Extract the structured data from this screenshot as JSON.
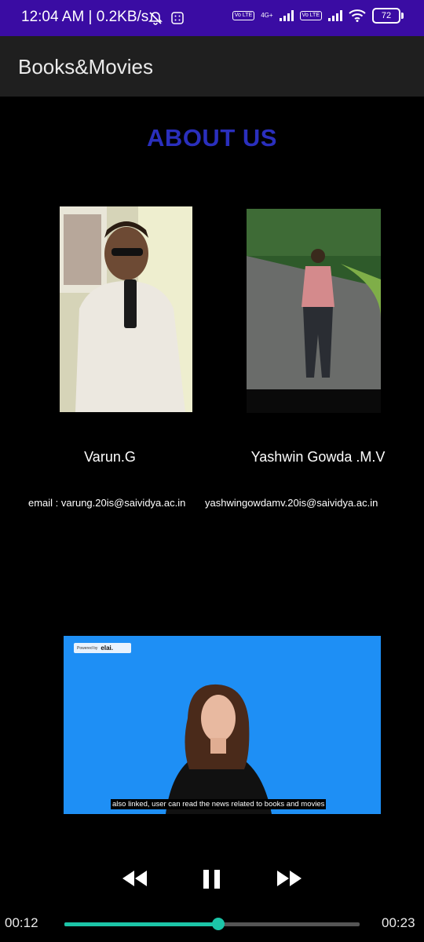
{
  "status_bar": {
    "time": "12:04 AM | 0.2KB/s",
    "volte1": "Vo LTE",
    "network": "4G+",
    "volte2": "Vo LTE",
    "battery": "72"
  },
  "app_bar": {
    "title": "Books&Movies"
  },
  "page": {
    "heading": "ABOUT US",
    "members": [
      {
        "name": "Varun.G",
        "email": "email : varung.20is@saividya.ac.in"
      },
      {
        "name": "Yashwin Gowda .M.V",
        "email": "yashwingowdamv.20is@saividya.ac.in"
      }
    ]
  },
  "video": {
    "badge_small": "Powered by",
    "badge_brand": "elai.",
    "caption": "also linked, user can read the news related to books and movies"
  },
  "player": {
    "elapsed": "00:12",
    "duration": "00:23",
    "progress": 0.52
  },
  "colors": {
    "status_bar": "#3a0ca3",
    "heading": "#2a2fbd",
    "accent": "#1cc5a8",
    "video_bg": "#1e8ff5"
  }
}
